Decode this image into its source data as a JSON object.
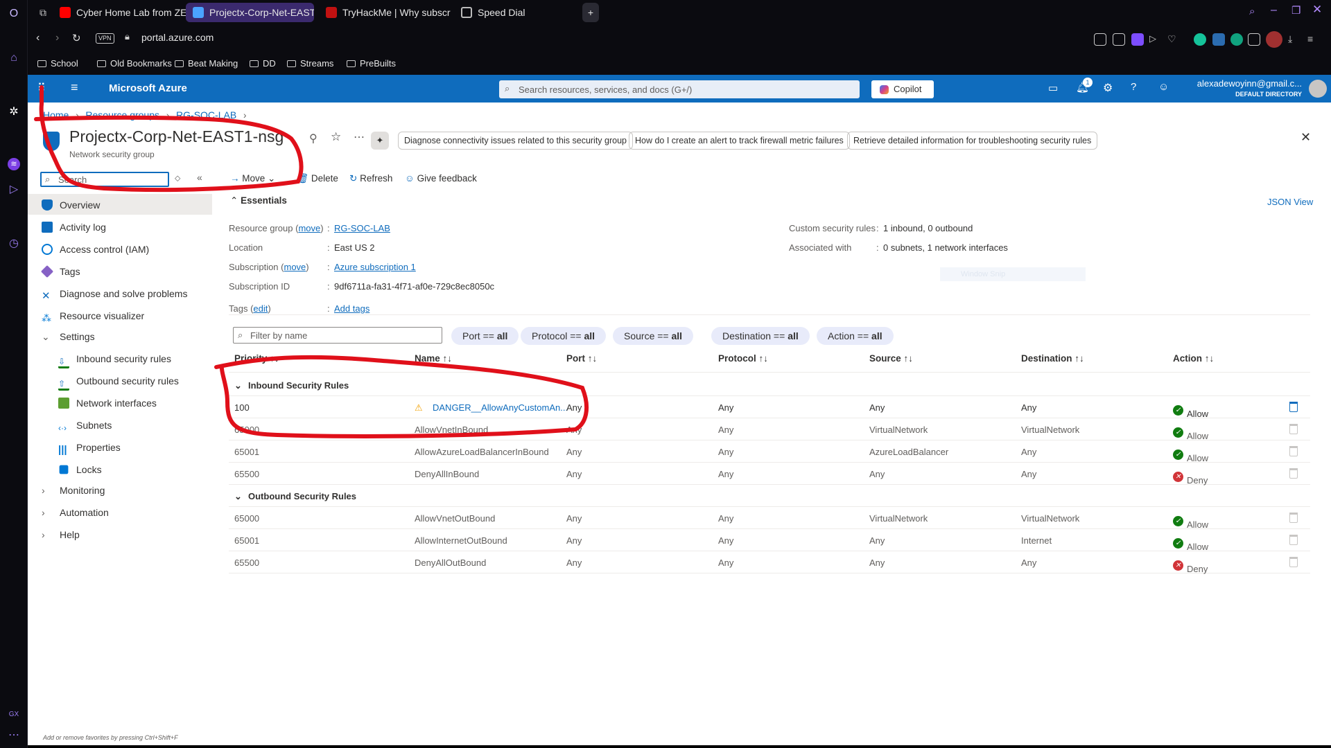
{
  "browser": {
    "tabs": [
      {
        "label": "Cyber Home Lab from ZE",
        "color": "#ff0000"
      },
      {
        "label": "Projectx-Corp-Net-EAST",
        "color": "#4aa3ff"
      },
      {
        "label": "TryHackMe | Why subscr",
        "color": "#c11111"
      },
      {
        "label": "Speed Dial",
        "color": "#bbbbbb"
      }
    ],
    "vpn_badge": "VPN",
    "url_host": "portal.azure.com",
    "bookmarks": [
      "School",
      "Old Bookmarks",
      "Beat Making",
      "DD",
      "Streams",
      "PreBuilts"
    ],
    "sidebar_label": "GX",
    "status_hint": "Add or remove favorites by pressing Ctrl+Shift+F"
  },
  "azure": {
    "brand": "Microsoft Azure",
    "search_placeholder": "Search resources, services, and docs (G+/)",
    "copilot_label": "Copilot",
    "notification_count": "1",
    "account_email": "alexadewoyinn@gmail.c...",
    "account_directory": "DEFAULT DIRECTORY"
  },
  "breadcrumb": [
    "Home",
    "Resource groups",
    "RG-SOC-LAB"
  ],
  "resource": {
    "title": "Projectx-Corp-Net-EAST1-nsg",
    "subtitle": "Network security group"
  },
  "copilot_chips": [
    "Diagnose connectivity issues related to this security group",
    "How do I create an alert to track firewall metric failures",
    "Retrieve detailed information for troubleshooting security rules"
  ],
  "sidebar": {
    "search_placeholder": "Search",
    "items": [
      {
        "label": "Overview",
        "icon": "shield-icon",
        "color": "#0f6cbd"
      },
      {
        "label": "Activity log",
        "icon": "log-icon",
        "color": "#0f6cbd"
      },
      {
        "label": "Access control (IAM)",
        "icon": "users-icon",
        "color": "#0078d4"
      },
      {
        "label": "Tags",
        "icon": "tag-icon",
        "color": "#8661c5"
      },
      {
        "label": "Diagnose and solve problems",
        "icon": "wrench-icon",
        "color": "#0f6cbd"
      },
      {
        "label": "Resource visualizer",
        "icon": "graph-icon",
        "color": "#0078d4"
      }
    ],
    "settings_label": "Settings",
    "settings_items": [
      {
        "label": "Inbound security rules",
        "icon": "inbound-icon"
      },
      {
        "label": "Outbound security rules",
        "icon": "outbound-icon"
      },
      {
        "label": "Network interfaces",
        "icon": "nic-icon"
      },
      {
        "label": "Subnets",
        "icon": "subnet-icon"
      },
      {
        "label": "Properties",
        "icon": "properties-icon"
      },
      {
        "label": "Locks",
        "icon": "lock-icon"
      }
    ],
    "groups": [
      "Monitoring",
      "Automation",
      "Help"
    ]
  },
  "toolbar": {
    "move": "Move",
    "delete": "Delete",
    "refresh": "Refresh",
    "feedback": "Give feedback"
  },
  "essentials": {
    "heading": "Essentials",
    "json_view": "JSON View",
    "move_link": "move",
    "edit_link": "edit",
    "left": [
      {
        "label": "Resource group",
        "value": "RG-SOC-LAB",
        "is_link": true
      },
      {
        "label": "Location",
        "value": "East US 2",
        "is_link": false
      },
      {
        "label": "Subscription",
        "value": "Azure subscription 1",
        "is_link": true
      },
      {
        "label": "Subscription ID",
        "value": "9df6711a-fa31-4f71-af0e-729c8ec8050c",
        "is_link": false
      },
      {
        "label": "Tags",
        "value": "Add tags",
        "is_link": true
      }
    ],
    "right": [
      {
        "label": "Custom security rules",
        "value": "1 inbound, 0 outbound"
      },
      {
        "label": "Associated with",
        "value": "0 subnets, 1 network interfaces"
      }
    ],
    "ghost_text": "Window Snip"
  },
  "filter": {
    "placeholder": "Filter by name",
    "pills": [
      {
        "key": "Port ==",
        "value": "all"
      },
      {
        "key": "Protocol ==",
        "value": "all"
      },
      {
        "key": "Source ==",
        "value": "all"
      },
      {
        "key": "Destination ==",
        "value": "all"
      },
      {
        "key": "Action ==",
        "value": "all"
      }
    ]
  },
  "table": {
    "columns": [
      "Priority",
      "Name",
      "Port",
      "Protocol",
      "Source",
      "Destination",
      "Action"
    ],
    "inbound_label": "Inbound Security Rules",
    "outbound_label": "Outbound Security Rules",
    "inbound": [
      {
        "priority": "100",
        "name": "DANGER__AllowAnyCustomAn...",
        "port": "Any",
        "protocol": "Any",
        "source": "Any",
        "destination": "Any",
        "action": "Allow",
        "warning": true
      },
      {
        "priority": "65000",
        "name": "AllowVnetInBound",
        "port": "Any",
        "protocol": "Any",
        "source": "VirtualNetwork",
        "destination": "VirtualNetwork",
        "action": "Allow"
      },
      {
        "priority": "65001",
        "name": "AllowAzureLoadBalancerInBound",
        "port": "Any",
        "protocol": "Any",
        "source": "AzureLoadBalancer",
        "destination": "Any",
        "action": "Allow"
      },
      {
        "priority": "65500",
        "name": "DenyAllInBound",
        "port": "Any",
        "protocol": "Any",
        "source": "Any",
        "destination": "Any",
        "action": "Deny"
      }
    ],
    "outbound": [
      {
        "priority": "65000",
        "name": "AllowVnetOutBound",
        "port": "Any",
        "protocol": "Any",
        "source": "VirtualNetwork",
        "destination": "VirtualNetwork",
        "action": "Allow"
      },
      {
        "priority": "65001",
        "name": "AllowInternetOutBound",
        "port": "Any",
        "protocol": "Any",
        "source": "Any",
        "destination": "Internet",
        "action": "Allow"
      },
      {
        "priority": "65500",
        "name": "DenyAllOutBound",
        "port": "Any",
        "protocol": "Any",
        "source": "Any",
        "destination": "Any",
        "action": "Deny"
      }
    ]
  },
  "colors": {
    "azure_blue": "#0f6cbd",
    "annotation_red": "#e0101a",
    "allow": "#107c10",
    "deny": "#d13438",
    "warning": "#f2a100"
  }
}
